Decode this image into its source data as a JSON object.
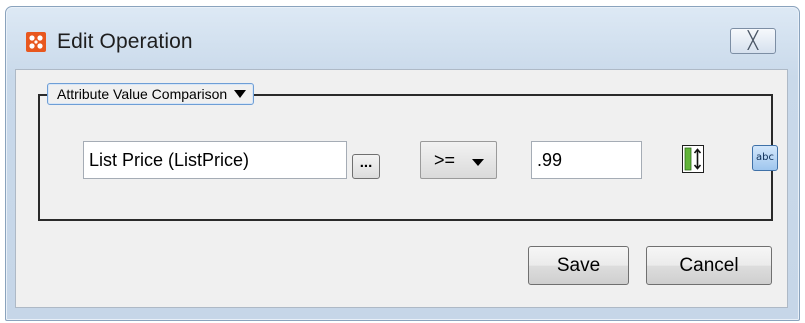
{
  "window": {
    "title": "Edit Operation",
    "close_glyph": "╳"
  },
  "group": {
    "selector_label": "Attribute Value Comparison"
  },
  "comparison": {
    "attribute_value": "List Price (ListPrice)",
    "browse_label": "...",
    "operator": ">=",
    "value": ".99",
    "text_type_label": "abc"
  },
  "buttons": {
    "save_label": "Save",
    "cancel_label": "Cancel"
  },
  "colors": {
    "app_icon": "#e8571e",
    "window_frame": "#c9d9ea",
    "client_background": "#f0f0f0"
  }
}
